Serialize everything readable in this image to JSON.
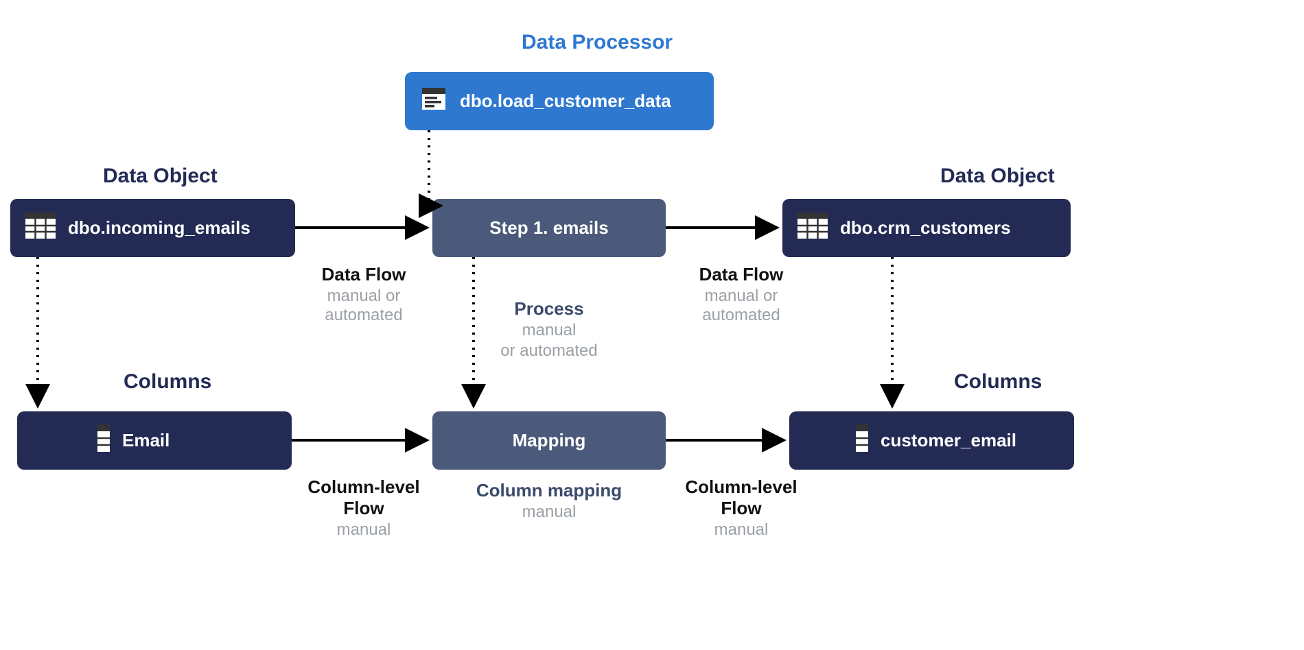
{
  "headings": {
    "data_processor": "Data Processor",
    "data_object_left": "Data Object",
    "data_object_right": "Data Object",
    "columns_left": "Columns",
    "columns_right": "Columns"
  },
  "nodes": {
    "processor": "dbo.load_customer_data",
    "source_table": "dbo.incoming_emails",
    "step": "Step 1. emails",
    "dest_table": "dbo.crm_customers",
    "source_column": "Email",
    "mapping": "Mapping",
    "dest_column": "customer_email"
  },
  "labels": {
    "data_flow_left": {
      "title": "Data Flow",
      "sub": "manual or automated"
    },
    "data_flow_right": {
      "title": "Data Flow",
      "sub": "manual or automated"
    },
    "process": {
      "title": "Process",
      "sub1": "manual",
      "sub2": "or automated"
    },
    "col_flow_left": {
      "title": "Column-level Flow",
      "sub": "manual"
    },
    "col_flow_right": {
      "title": "Column-level Flow",
      "sub": "manual"
    },
    "col_mapping": {
      "title": "Column mapping",
      "sub": "manual"
    }
  },
  "colors": {
    "dark": "#232b55",
    "mid": "#4b5a7a",
    "blue": "#2e78d0",
    "grey": "#9aa0a6"
  }
}
